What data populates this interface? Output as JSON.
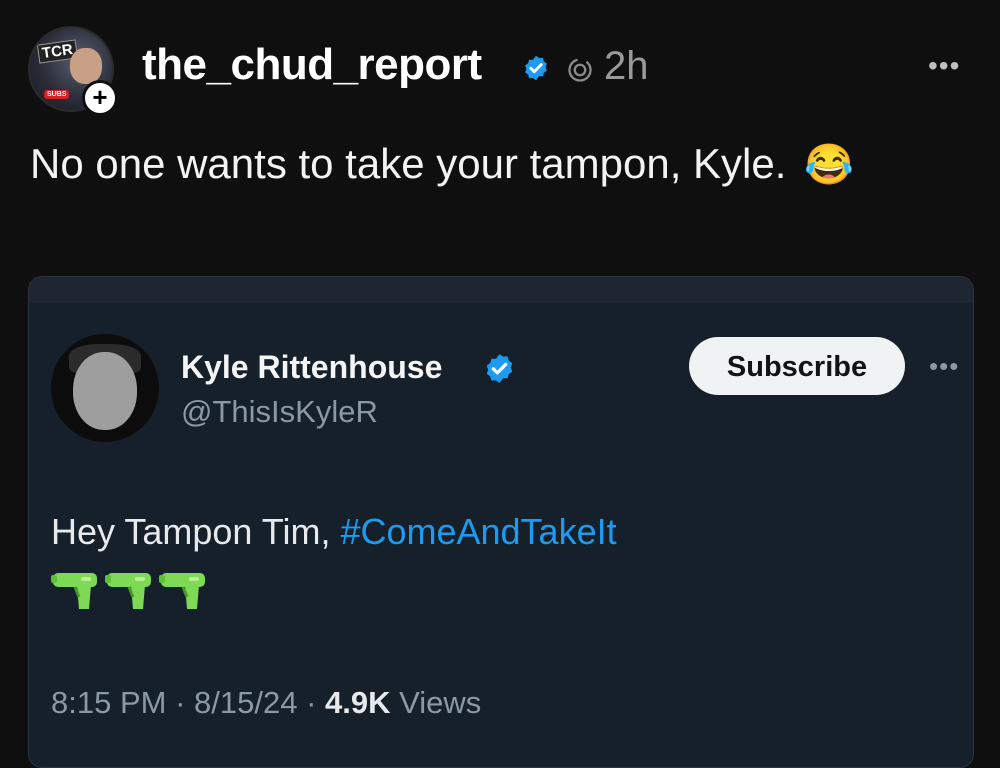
{
  "post": {
    "username": "the_chud_report",
    "time": "2h",
    "avatar_label": "TCR",
    "avatar_badge": "SUBS",
    "follow_symbol": "+",
    "more_symbol": "•••",
    "text": "No one wants to take your tampon, Kyle.",
    "emoji": "😂"
  },
  "quote": {
    "name": "Kyle Rittenhouse",
    "handle": "@ThisIsKyleR",
    "subscribe_label": "Subscribe",
    "more_symbol": "•••",
    "text_prefix": "Hey Tampon Tim, ",
    "hashtag": "#ComeAndTakeIt",
    "time": "8:15 PM",
    "date": "8/15/24",
    "separator": " · ",
    "views_count": "4.9K",
    "views_label": " Views",
    "gun_emoji_count": 3
  },
  "colors": {
    "background": "#0f0f10",
    "card": "#15202b",
    "verified": "#1d9bf0",
    "hashtag": "#1d9bf0",
    "gun": "#7ed957"
  },
  "icons": [
    "verified-badge-icon",
    "threads-icon",
    "more-icon",
    "water-gun-icon",
    "plus-icon"
  ]
}
